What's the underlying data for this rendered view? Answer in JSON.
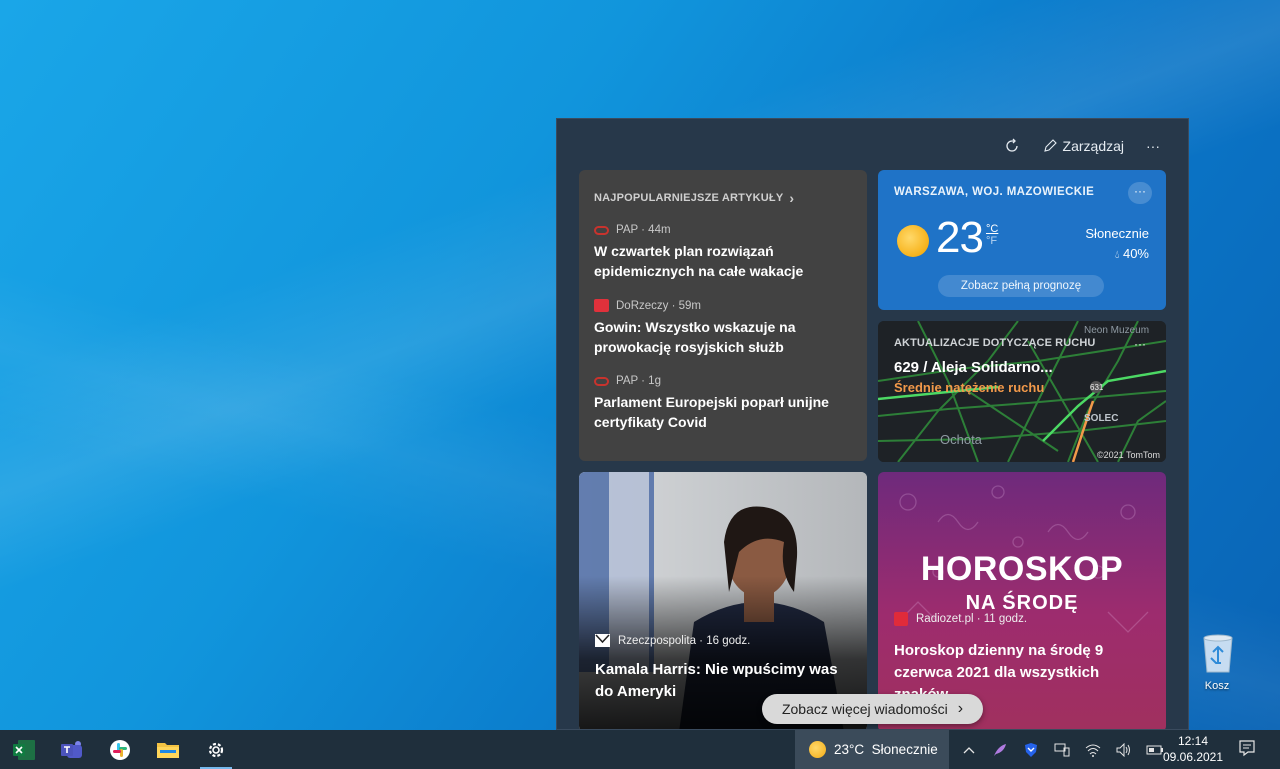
{
  "desktop": {
    "recycle_bin_label": "Kosz"
  },
  "panel": {
    "header": {
      "refresh_icon": "refresh-icon",
      "manage_label": "Zarządzaj",
      "more_label": "···"
    },
    "top_articles": {
      "title": "NAJPOPULARNIEJSZE ARTYKUŁY",
      "chevron": "›",
      "items": [
        {
          "source": "PAP · 44m",
          "title": "W czwartek plan rozwiązań epidemicznych na całe wakacje"
        },
        {
          "source": "DoRzeczy · 59m",
          "title": "Gowin: Wszystko wskazuje na prowokację rosyjskich służb"
        },
        {
          "source": "PAP · 1g",
          "title": "Parlament Europejski poparł unijne certyfikaty Covid"
        }
      ]
    },
    "weather": {
      "location": "WARSZAWA, WOJ. MAZOWIECKIE",
      "more": "···",
      "temperature": "23",
      "unit_c": "°C",
      "unit_f": "°F",
      "condition": "Słonecznie",
      "precipitation": "40%",
      "forecast_button": "Zobacz pełną prognozę"
    },
    "traffic": {
      "title": "AKTUALIZACJE DOTYCZĄCE RUCHU",
      "more": "···",
      "road": "629 / Aleja Solidarno...",
      "status": "Średnie natężenie ruchu",
      "place": "Ochota",
      "place2": "Neon Muzeum",
      "place3": "SOLEC",
      "road_number": "631",
      "copyright": "©2021 TomTom"
    },
    "harris_card": {
      "source": "Rzeczpospolita · 16 godz.",
      "title": "Kamala Harris: Nie wpuścimy was do Ameryki"
    },
    "horoscope_card": {
      "big_title": "HOROSKOP",
      "sub_title": "NA ŚRODĘ",
      "source": "Radiozet.pl · 11 godz.",
      "title": "Horoskop dzienny na środę 9 czerwca 2021 dla wszystkich znaków"
    },
    "see_more": "Zobacz więcej wiadomości",
    "see_more_chevron": "›"
  },
  "taskbar": {
    "weather_text": "23°C  Słonecznie",
    "time": "12:14",
    "date": "09.06.2021"
  },
  "colors": {
    "accent": "#1f73c7",
    "traffic_status": "#f2994a",
    "panel_bg": "#27384a"
  }
}
